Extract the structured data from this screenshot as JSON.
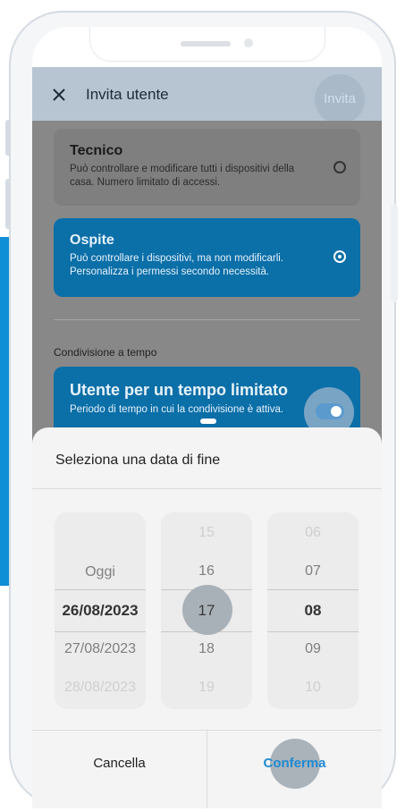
{
  "header": {
    "title": "Invita utente",
    "invite_label": "Invita"
  },
  "roles": [
    {
      "title": "Tecnico",
      "desc": "Può controllare e modificare tutti i dispositivi della casa. Numero limitato di accessi.",
      "selected": false
    },
    {
      "title": "Ospite",
      "desc": "Può controllare i dispositivi, ma non modificarli. Personalizza i permessi secondo necessità.",
      "selected": true
    }
  ],
  "timed_section": {
    "label": "Condivisione a tempo",
    "card_title": "Utente per un tempo limitato",
    "card_desc": "Periodo di tempo in cui la condivisione è attiva.",
    "enabled": true
  },
  "date_sheet": {
    "title": "Seleziona una data di fine",
    "dates": [
      "Oggi",
      "26/08/2023",
      "27/08/2023",
      "28/08/2023"
    ],
    "hours": [
      "15",
      "16",
      "17",
      "18",
      "19"
    ],
    "minutes": [
      "06",
      "07",
      "08",
      "09",
      "10"
    ],
    "selected_date": "26/08/2023",
    "selected_hour": "17",
    "selected_minute": "08",
    "cancel_label": "Cancella",
    "confirm_label": "Conferma"
  },
  "colors": {
    "accent": "#0b6fa8",
    "confirm": "#1f8ad1"
  }
}
